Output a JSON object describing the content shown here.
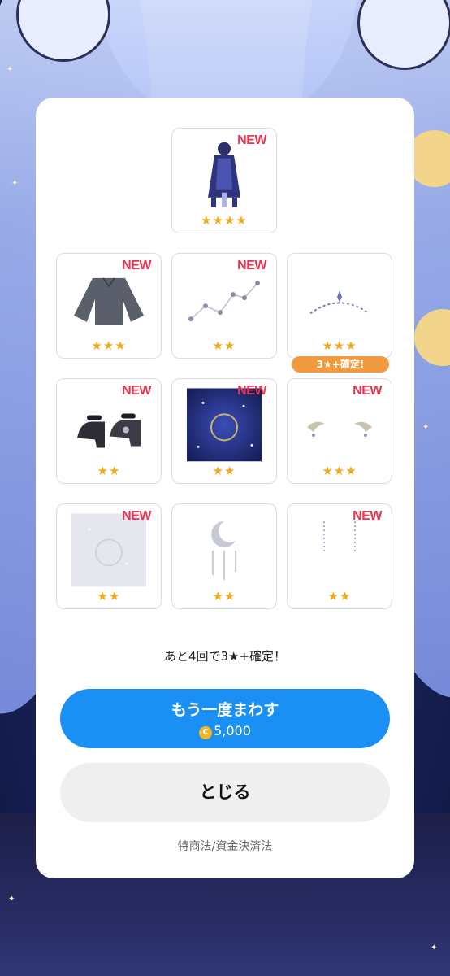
{
  "items": [
    {
      "new_label": "NEW",
      "stars": "★★★★",
      "icon": "dress-outfit-icon"
    },
    {
      "new_label": "NEW",
      "stars": "★★★",
      "icon": "gray-blouse-icon"
    },
    {
      "new_label": "NEW",
      "stars": "★★",
      "icon": "constellation-icon"
    },
    {
      "new_label": "",
      "stars": "★★★",
      "icon": "tiara-icon"
    },
    {
      "new_label": "NEW",
      "stars": "★★",
      "icon": "black-heels-icon"
    },
    {
      "new_label": "NEW",
      "stars": "★★",
      "icon": "starry-background-icon"
    },
    {
      "new_label": "NEW",
      "stars": "★★★",
      "icon": "ear-ornament-icon"
    },
    {
      "new_label": "NEW",
      "stars": "★★",
      "icon": "silver-background-icon"
    },
    {
      "new_label": "",
      "stars": "★★",
      "icon": "moon-pendant-icon"
    },
    {
      "new_label": "NEW",
      "stars": "★★",
      "icon": "moon-earrings-icon"
    }
  ],
  "guarantee_badge": "3★+確定!",
  "remaining_text": "あと4回で3★+確定！",
  "spin_again": {
    "label": "もう一度まわす",
    "coin_symbol": "C",
    "cost": "5,000"
  },
  "close_label": "とじる",
  "legal_link": "特商法/資金決済法",
  "colors": {
    "new": "#e73552",
    "star": "#f3a81c",
    "primary": "#1b90f4",
    "badge": "#f29a3e"
  }
}
